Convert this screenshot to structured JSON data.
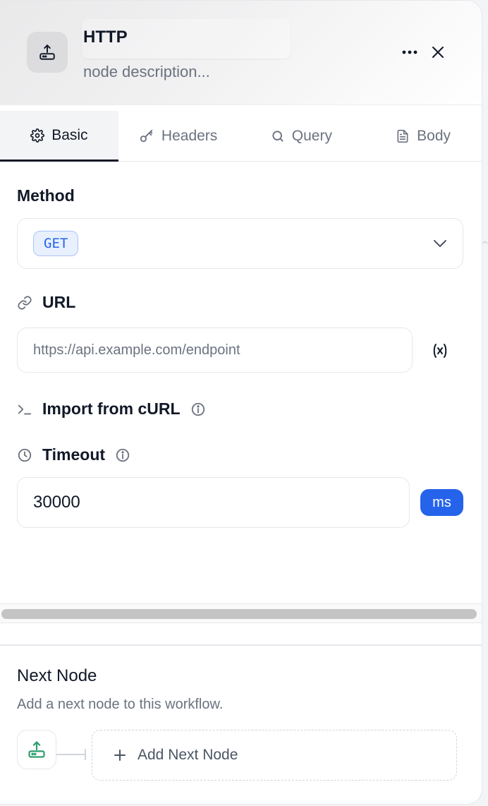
{
  "header": {
    "title": "HTTP",
    "description_placeholder": "node description..."
  },
  "tabs": [
    {
      "label": "Basic",
      "icon": "gear-icon",
      "active": true
    },
    {
      "label": "Headers",
      "icon": "key-icon",
      "active": false
    },
    {
      "label": "Query",
      "icon": "search-icon",
      "active": false
    },
    {
      "label": "Body",
      "icon": "document-icon",
      "active": false
    }
  ],
  "method": {
    "label": "Method",
    "selected": "GET"
  },
  "url": {
    "label": "URL",
    "placeholder": "https://api.example.com/endpoint",
    "value": ""
  },
  "curl": {
    "label": "Import from cURL"
  },
  "timeout": {
    "label": "Timeout",
    "value": "30000",
    "unit": "ms"
  },
  "next_node": {
    "title": "Next Node",
    "subtitle": "Add a next node to this workflow.",
    "add_label": "Add Next Node"
  },
  "colors": {
    "accent": "#2563eb",
    "method_badge_bg": "#e8f0fd",
    "node_icon_green": "#2f9e6f"
  }
}
